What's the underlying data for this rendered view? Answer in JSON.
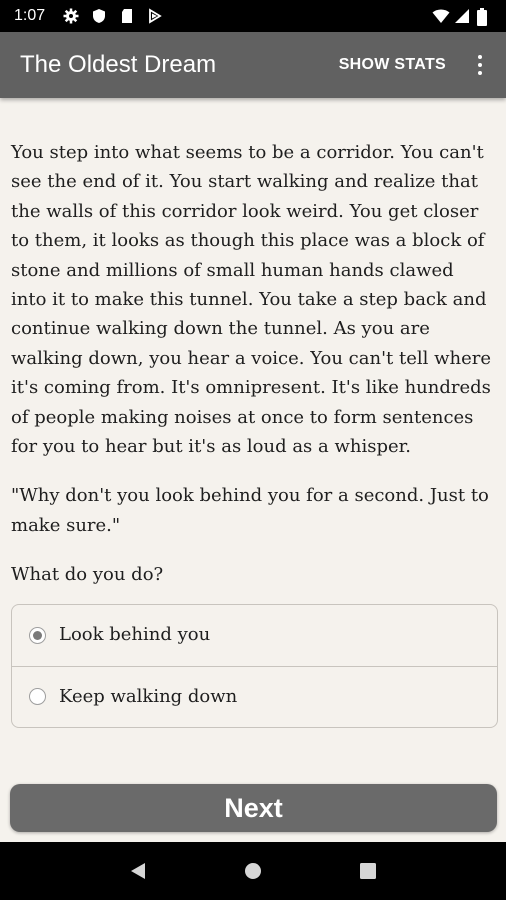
{
  "status_bar": {
    "time": "1:07",
    "left_icons": [
      "gear-icon",
      "shield-icon",
      "sd-card-icon",
      "play-protect-icon"
    ],
    "right_icons": [
      "wifi-icon",
      "signal-icon",
      "battery-icon"
    ]
  },
  "app_bar": {
    "title": "The Oldest Dream",
    "show_stats_label": "SHOW STATS",
    "overflow_icon": "overflow-menu-icon"
  },
  "story": {
    "paragraph_1": "You step into what seems to be a corridor. You can't see the end of it. You start walking and realize that the walls of this corridor look weird. You get closer to them, it looks as though this place was a block of stone and millions of small human hands clawed into it to make this tunnel. You take a step back and continue walking down the tunnel. As you are walking down, you hear a voice. You can't tell where it's coming from. It's omnipresent. It's like hundreds of people making noises at once to form sentences for you to hear but it's as loud as a whisper.",
    "paragraph_2": "\"Why don't you look behind you for a second. Just to make sure.\"",
    "question": "What do you do?"
  },
  "choices": [
    {
      "label": "Look behind you",
      "selected": true
    },
    {
      "label": "Keep walking down",
      "selected": false
    }
  ],
  "next_button": {
    "label": "Next"
  },
  "nav_bar": {
    "icons": [
      "back-icon",
      "home-icon",
      "recents-icon"
    ]
  },
  "colors": {
    "app_bar": "#616161",
    "background": "#f5f2ed",
    "button": "#6a6a6a"
  }
}
